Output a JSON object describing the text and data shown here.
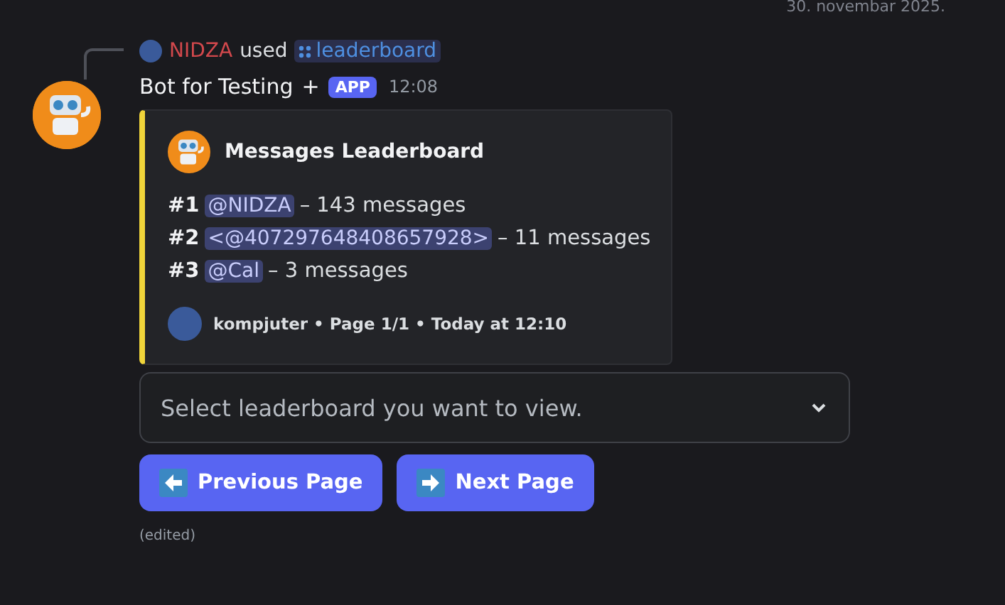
{
  "date_divider": "30. novembar 2025.",
  "reply": {
    "user": "NIDZA",
    "verb": "used",
    "command": "leaderboard"
  },
  "header": {
    "author": "Bot for Testing",
    "plus": "+",
    "badge": "APP",
    "time": "12:08"
  },
  "embed": {
    "title": "Messages Leaderboard",
    "color": "#f0d43a",
    "entries": [
      {
        "rank": "#1",
        "mention": "@NIDZA",
        "text": "– 143 messages"
      },
      {
        "rank": "#2",
        "mention": "<@407297648408657928>",
        "text": "– 11 messages"
      },
      {
        "rank": "#3",
        "mention": "@Cal",
        "text": "– 3 messages"
      }
    ],
    "footer": "kompjuter • Page 1/1 • Today at 12:10"
  },
  "select": {
    "placeholder": "Select leaderboard you want to view."
  },
  "buttons": [
    {
      "kind": "previous",
      "label": "Previous Page"
    },
    {
      "kind": "next",
      "label": "Next Page"
    }
  ],
  "edited": "(edited)"
}
